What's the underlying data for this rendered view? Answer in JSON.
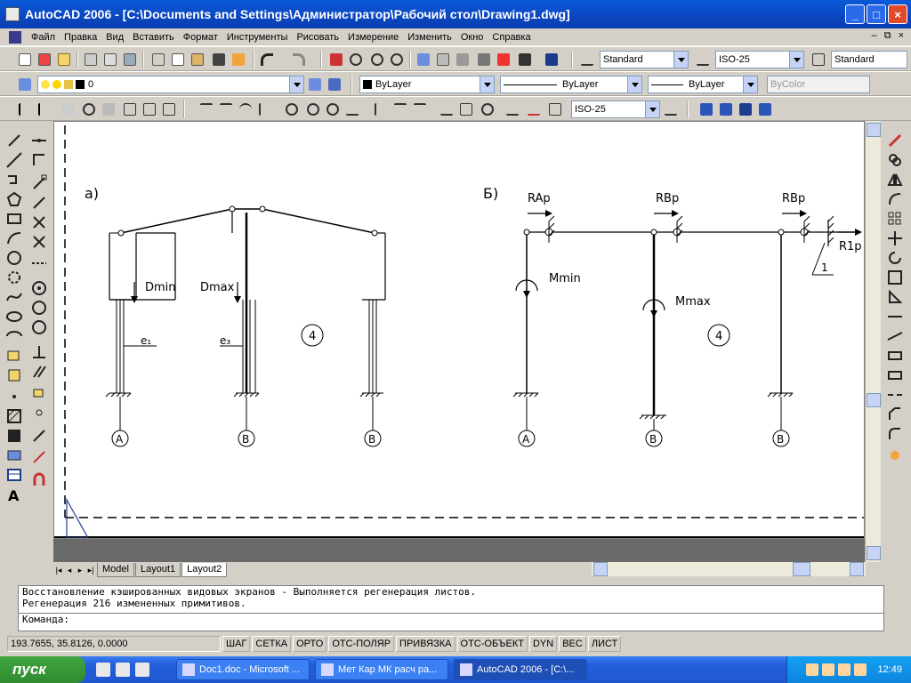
{
  "window": {
    "title": "AutoCAD 2006 - [C:\\Documents and Settings\\Администратор\\Рабочий стол\\Drawing1.dwg]",
    "minimize": "_",
    "maximize": "□",
    "close": "×"
  },
  "menu": [
    "Файл",
    "Правка",
    "Вид",
    "Вставить",
    "Формат",
    "Инструменты",
    "Рисовать",
    "Измерение",
    "Изменить",
    "Окно",
    "Справка"
  ],
  "doc_controls": {
    "minimize": "–",
    "restore": "⧉",
    "close": "×"
  },
  "toolbar1": {
    "text_style": "Standard",
    "dim_style": "ISO-25",
    "table_style": "Standard"
  },
  "toolbar2": {
    "layer": "0",
    "color": "ByLayer",
    "linetype": "ByLayer",
    "lineweight": "ByLayer",
    "plotstyle": "ByColor"
  },
  "toolbar3": {
    "dim_style": "ISO-25"
  },
  "drawing": {
    "a": {
      "label": "a)",
      "dmin": "Dmin",
      "dmax": "Dmax",
      "e1": "e₁",
      "e3": "e₃",
      "circle": "4",
      "axes": [
        "A",
        "B",
        "B"
      ]
    },
    "b": {
      "label": "Б)",
      "rap": "RAp",
      "rbp1": "RBp",
      "rbp2": "RBp",
      "r1p": "R1p",
      "mmin": "Mmin",
      "mmax": "Mmax",
      "circle": "4",
      "num": "1",
      "axes": [
        "A",
        "B",
        "B"
      ]
    }
  },
  "tabs": {
    "model": "Model",
    "layout1": "Layout1",
    "layout2": "Layout2"
  },
  "command": {
    "line1": "Восстановление кэшированных видовых экранов - Выполняется регенерация листов.",
    "line2": "Регенерация 216 измененных примитивов.",
    "prompt": "Команда:"
  },
  "status": {
    "coords": "193.7655, 35.8126, 0.0000",
    "buttons": [
      "ШАГ",
      "СЕТКА",
      "ОРТО",
      "ОТС-ПОЛЯР",
      "ПРИВЯЗКА",
      "ОТС-ОБЪЕКТ",
      "DYN",
      "ВЕС",
      "ЛИСТ"
    ]
  },
  "taskbar": {
    "start": "пуск",
    "tasks": [
      "Doc1.doc - Microsoft ...",
      "Мет Кар МК расч ра...",
      "AutoCAD 2006 - [C:\\..."
    ],
    "clock": "12:49"
  }
}
